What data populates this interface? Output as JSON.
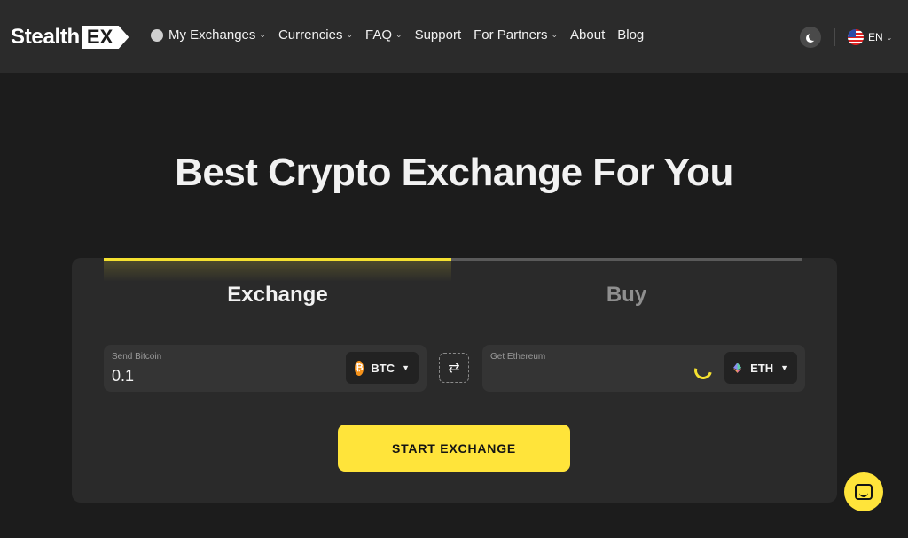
{
  "header": {
    "logo_main": "Stealth",
    "logo_badge": "EX",
    "nav": [
      {
        "label": "My Exchanges",
        "has_dropdown": true,
        "icon": "circle-icon"
      },
      {
        "label": "Currencies",
        "has_dropdown": true
      },
      {
        "label": "FAQ",
        "has_dropdown": true
      },
      {
        "label": "Support",
        "has_dropdown": false
      },
      {
        "label": "For Partners",
        "has_dropdown": true
      },
      {
        "label": "About",
        "has_dropdown": false
      },
      {
        "label": "Blog",
        "has_dropdown": false
      }
    ],
    "theme_icon": "moon-icon",
    "language": "EN"
  },
  "hero": {
    "title": "Best Crypto Exchange For You"
  },
  "widget": {
    "tabs": [
      {
        "label": "Exchange",
        "active": true
      },
      {
        "label": "Buy",
        "active": false
      }
    ],
    "send": {
      "label": "Send Bitcoin",
      "value": "0.1",
      "currency": "BTC",
      "icon": "bitcoin-icon"
    },
    "get": {
      "label": "Get Ethereum",
      "value": "",
      "currency": "ETH",
      "icon": "ethereum-icon",
      "loading": true
    },
    "swap_icon": "swap-arrows-icon",
    "start_label": "START EXCHANGE"
  },
  "colors": {
    "accent": "#ffe43a",
    "background": "#1c1c1c",
    "header": "#2b2b2b",
    "card": "#2a2a2a",
    "bitcoin": "#f7931a"
  }
}
